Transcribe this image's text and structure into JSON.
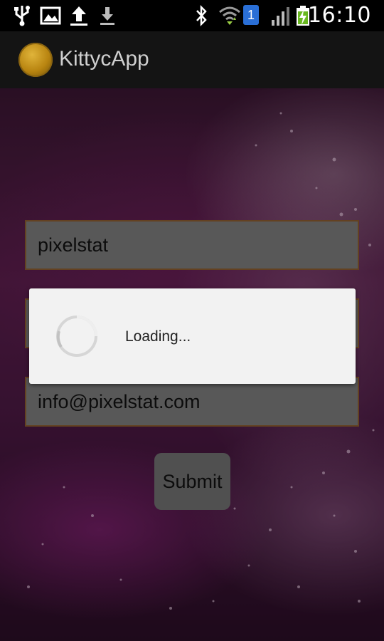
{
  "status_bar": {
    "time": "16:10",
    "notification_badge": "1",
    "icons": [
      "usb-icon",
      "image-icon",
      "upload-icon",
      "download-icon",
      "bluetooth-icon",
      "wifi-icon",
      "sim-badge-icon",
      "signal-icon",
      "battery-charging-icon"
    ]
  },
  "action_bar": {
    "title": "KittycApp",
    "logo": "app-logo-icon"
  },
  "form": {
    "name_value": "pixelstat",
    "hidden_value": "",
    "email_value": "info@pixelstat.com",
    "submit_label": "Submit"
  },
  "dialog": {
    "text": "Loading..."
  }
}
